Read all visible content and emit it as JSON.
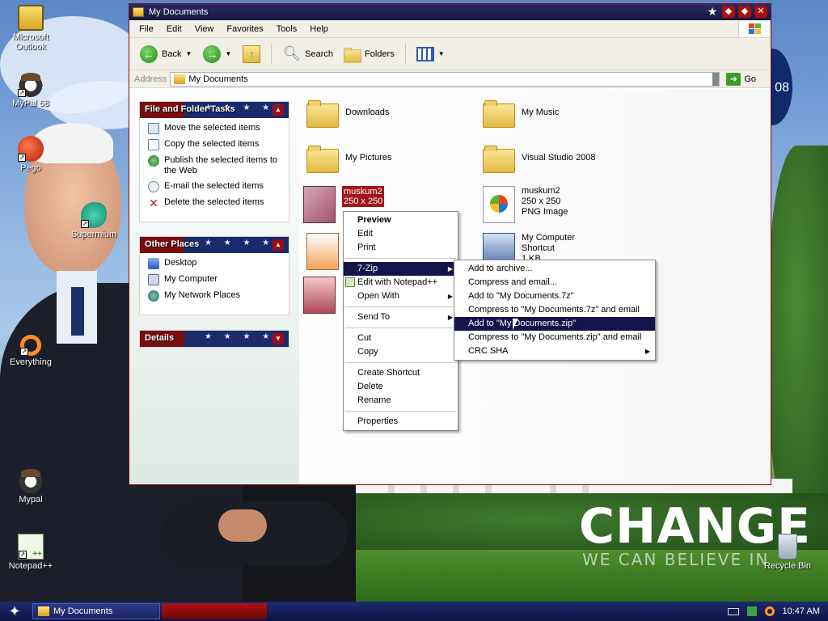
{
  "desktop": {
    "icons": [
      {
        "label": "Microsoft Outlook"
      },
      {
        "label": "MyPal 68"
      },
      {
        "label": "Pego"
      },
      {
        "label": "Supermium"
      },
      {
        "label": "Everything"
      },
      {
        "label": "Mypal"
      },
      {
        "label": "Notepad++"
      },
      {
        "label": "Recycle Bin"
      }
    ],
    "wallpaper_text": {
      "headline": "CHANGE",
      "sub": "WE CAN BELIEVE IN",
      "logo_fragment": "08"
    }
  },
  "window": {
    "title": "My Documents",
    "menu": [
      "File",
      "Edit",
      "View",
      "Favorites",
      "Tools",
      "Help"
    ],
    "toolbar": {
      "back": "Back",
      "search": "Search",
      "folders": "Folders"
    },
    "address": {
      "label": "Address",
      "value": "My Documents",
      "go": "Go"
    }
  },
  "left_pane": {
    "file_tasks": {
      "title": "File and Folder Tasks",
      "items": [
        "Move the selected items",
        "Copy the selected items",
        "Publish the selected items to the Web",
        "E-mail the selected items",
        "Delete the selected items"
      ]
    },
    "other_places": {
      "title": "Other Places",
      "items": [
        "Desktop",
        "My Computer",
        "My Network Places"
      ]
    },
    "details": {
      "title": "Details"
    }
  },
  "files": [
    {
      "name": "Downloads"
    },
    {
      "name": "My Music"
    },
    {
      "name": "My Pictures"
    },
    {
      "name": "Visual Studio 2008"
    },
    {
      "name": "muskum2",
      "dims": "250 x 250"
    },
    {
      "name": "muskum2",
      "dims": "250 x 250",
      "type": "PNG Image"
    },
    {
      "name": "My Computer",
      "line2": "Shortcut",
      "line3": "1 KB"
    }
  ],
  "context_menu": {
    "items": {
      "preview": "Preview",
      "edit": "Edit",
      "print": "Print",
      "sevenzip": "7-Zip",
      "notepadpp": "Edit with Notepad++",
      "open_with": "Open With",
      "send_to": "Send To",
      "cut": "Cut",
      "copy": "Copy",
      "create_shortcut": "Create Shortcut",
      "delete": "Delete",
      "rename": "Rename",
      "properties": "Properties"
    }
  },
  "zip_submenu": {
    "items": [
      "Add to archive...",
      "Compress and email...",
      "Add to \"My Documents.7z\"",
      "Compress to \"My Documents.7z\" and email",
      "Add to \"My Documents.zip\"",
      "Compress to \"My Documents.zip\" and email",
      "CRC SHA"
    ]
  },
  "taskbar": {
    "window_button": "My Documents",
    "clock": "10:47 AM"
  },
  "colors": {
    "titlebar": "#151540",
    "highlight": "#14144a",
    "panel_red": "#7a0d12",
    "panel_blue": "#1a2b6d"
  }
}
